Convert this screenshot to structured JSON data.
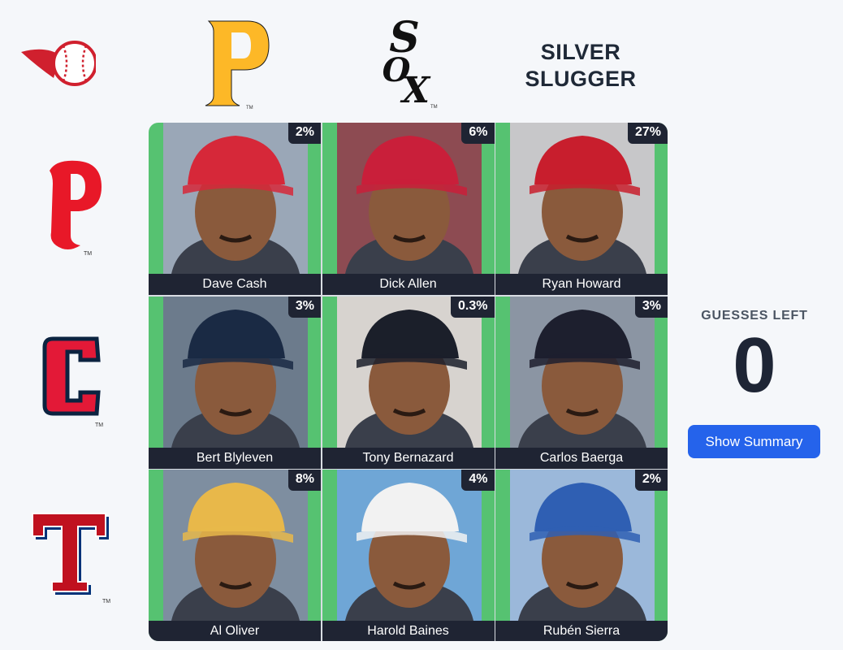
{
  "columns": [
    {
      "team": "Pittsburgh Pirates",
      "logo_icon": "pirates-p-logo-icon",
      "mark": "P"
    },
    {
      "team": "Chicago White Sox",
      "logo_icon": "white-sox-logo-icon",
      "mark": "SOX"
    },
    {
      "label": "SILVER SLUGGER"
    }
  ],
  "rows": [
    {
      "team": "Philadelphia Phillies",
      "logo_icon": "phillies-logo-icon",
      "mark": "P"
    },
    {
      "team": "Cleveland Guardians",
      "logo_icon": "guardians-c-logo-icon",
      "mark": "C"
    },
    {
      "team": "Texas Rangers",
      "logo_icon": "rangers-t-logo-icon",
      "mark": "T"
    }
  ],
  "cells": [
    {
      "player": "Dave Cash",
      "pct": "2%",
      "cap": "#d62839",
      "bg": "#9aa7b7"
    },
    {
      "player": "Dick Allen",
      "pct": "6%",
      "cap": "#c91f3a",
      "bg": "#8d4b52"
    },
    {
      "player": "Ryan Howard",
      "pct": "27%",
      "cap": "#c81e2d",
      "bg": "#c7c7c9"
    },
    {
      "player": "Bert Blyleven",
      "pct": "3%",
      "cap": "#1a2a44",
      "bg": "#6c7b8c"
    },
    {
      "player": "Tony Bernazard",
      "pct": "0.3%",
      "cap": "#1b1f2a",
      "bg": "#d7d3cf"
    },
    {
      "player": "Carlos Baerga",
      "pct": "3%",
      "cap": "#1d1f2e",
      "bg": "#8b95a3"
    },
    {
      "player": "Al Oliver",
      "pct": "8%",
      "cap": "#e8b84a",
      "bg": "#7e8ea0"
    },
    {
      "player": "Harold Baines",
      "pct": "4%",
      "cap": "#f2f2f2",
      "bg": "#6fa6d6"
    },
    {
      "player": "Rubén Sierra",
      "pct": "2%",
      "cap": "#2f5fb3",
      "bg": "#9bb8da"
    }
  ],
  "sidebar": {
    "guesses_label": "GUESSES LEFT",
    "guesses_count": "0",
    "summary_button": "Show Summary"
  },
  "colors": {
    "correct": "#56c271",
    "overlay": "#1f2433",
    "button": "#2563eb"
  }
}
